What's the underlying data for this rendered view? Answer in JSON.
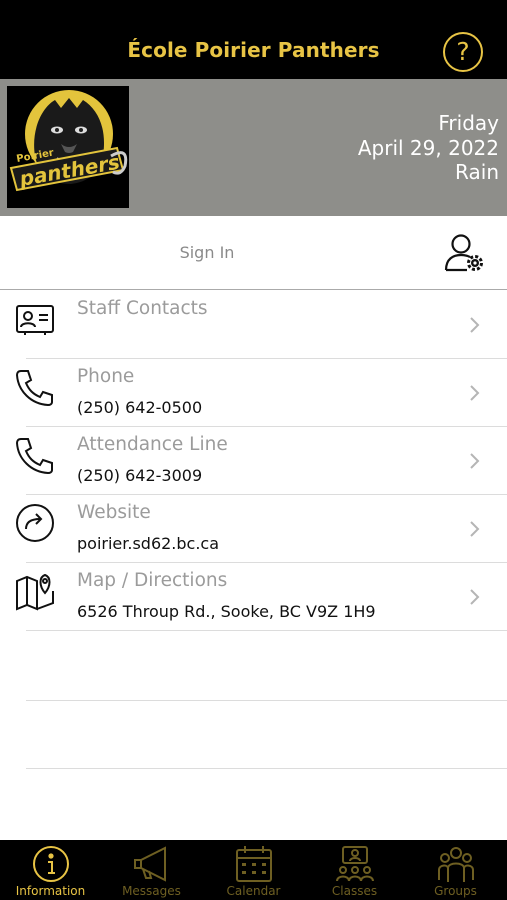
{
  "header": {
    "title": "École Poirier Panthers",
    "help_icon": "question-circle-icon"
  },
  "banner": {
    "logo": {
      "alt": "Poirier Panthers logo",
      "text_top": "Poirier",
      "text_main": "panthers"
    },
    "day": "Friday",
    "date": "April 29, 2022",
    "weather": "Rain"
  },
  "signin": {
    "label": "Sign In",
    "icon": "user-settings-icon"
  },
  "contacts": [
    {
      "label": "Staff Contacts",
      "value": "",
      "icon": "contact-card-icon"
    },
    {
      "label": "Phone",
      "value": "(250) 642-0500",
      "icon": "phone-icon"
    },
    {
      "label": "Attendance Line",
      "value": "(250) 642-3009",
      "icon": "phone-icon"
    },
    {
      "label": "Website",
      "value": "poirier.sd62.bc.ca",
      "icon": "share-arrow-icon"
    },
    {
      "label": "Map / Directions",
      "value": "6526 Throup Rd., Sooke, BC V9Z 1H9",
      "icon": "map-pin-icon"
    }
  ],
  "tabs": [
    {
      "label": "Information",
      "icon": "info-icon",
      "active": true
    },
    {
      "label": "Messages",
      "icon": "megaphone-icon",
      "active": false
    },
    {
      "label": "Calendar",
      "icon": "calendar-icon",
      "active": false
    },
    {
      "label": "Classes",
      "icon": "classes-icon",
      "active": false
    },
    {
      "label": "Groups",
      "icon": "groups-icon",
      "active": false
    }
  ],
  "colors": {
    "accent": "#e8c445",
    "header_bg": "#000000",
    "banner_bg": "#8e8e8a",
    "tab_inactive": "#6e5f22"
  }
}
